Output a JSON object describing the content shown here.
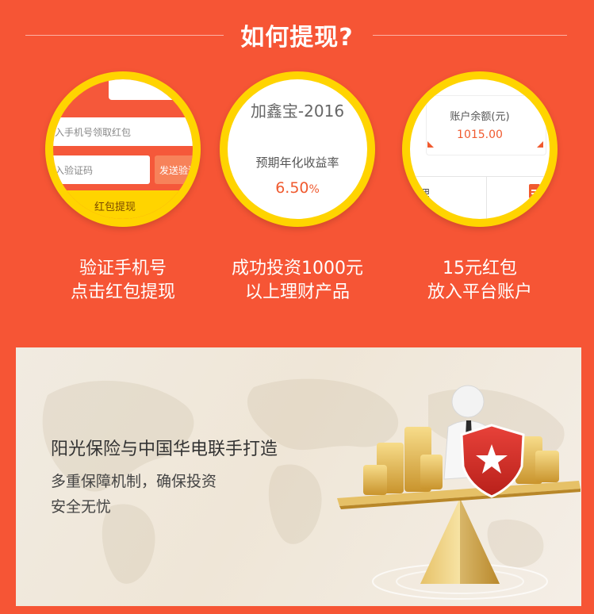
{
  "header": {
    "title": "如何提现?"
  },
  "steps": [
    {
      "mock": {
        "phone_placeholder": "入手机号领取红包",
        "code_placeholder": "入验证码",
        "send_button": "发送验证",
        "withdraw_button": "红包提现"
      },
      "caption": [
        "验证手机号",
        "点击红包提现"
      ]
    },
    {
      "mock": {
        "product_name": "加鑫宝-2016",
        "rate_label": "预期年化收益率",
        "rate_value": "6.50",
        "rate_unit": "%"
      },
      "caption": [
        "成功投资1000元",
        "以上理财产品"
      ]
    },
    {
      "mock": {
        "balance_label": "账户余额(元)",
        "balance_value": "1015.00",
        "list_text": "理"
      },
      "caption": [
        "15元红包",
        "放入平台账户"
      ]
    }
  ],
  "banner": {
    "title": "阳光保险与中国华电联手打造",
    "line1": "多重保障机制，确保投资",
    "line2": "安全无忧"
  },
  "icons": {
    "shield": "shield-star-icon",
    "document": "document-icon"
  },
  "colors": {
    "background": "#f65535",
    "circle_ring": "#ffd400",
    "accent_text": "#f05a2f"
  }
}
